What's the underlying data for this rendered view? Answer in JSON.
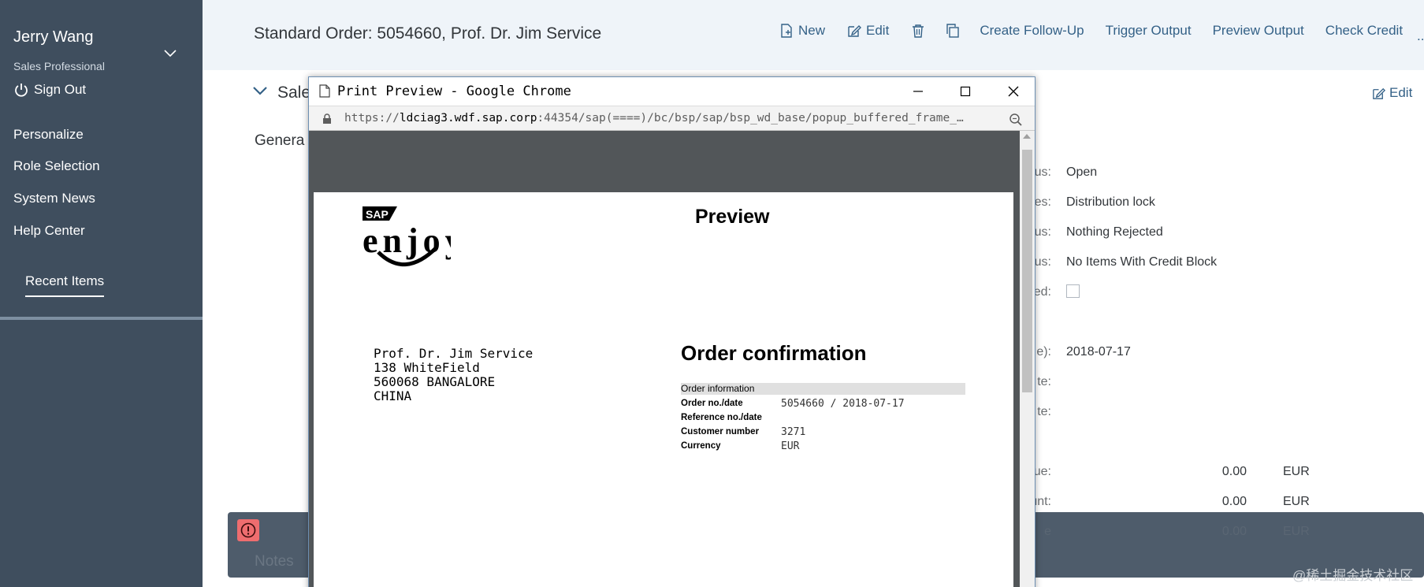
{
  "sidebar": {
    "user_name": "Jerry Wang",
    "user_role": "Sales Professional",
    "sign_out": "Sign Out",
    "links": [
      "Personalize",
      "Role Selection",
      "System News",
      "Help Center"
    ],
    "recent_items": "Recent Items"
  },
  "header": {
    "title": "Standard Order: 5054660, Prof. Dr. Jim Service",
    "new_label": "New",
    "edit_label": "Edit",
    "create_follow_up": "Create Follow-Up",
    "trigger_output": "Trigger Output",
    "preview_output": "Preview Output",
    "check_credit": "Check Credit",
    "more": "..."
  },
  "section": {
    "title": "Sale",
    "edit_label": "Edit",
    "general": "Genera"
  },
  "fields": [
    {
      "label": "us:",
      "value": "Open"
    },
    {
      "label": "es:",
      "value": "Distribution lock"
    },
    {
      "label": "us:",
      "value": "Nothing Rejected"
    },
    {
      "label": "us:",
      "value": "No Items With Credit Block"
    },
    {
      "label": "ed:",
      "value": ""
    },
    {
      "label": "e):",
      "value": "2018-07-17"
    },
    {
      "label": "te:",
      "value": ""
    },
    {
      "label": "te:",
      "value": ""
    }
  ],
  "amounts": [
    {
      "label": "ue:",
      "value": "0.00",
      "currency": "EUR"
    },
    {
      "label": "unt:",
      "value": "0.00",
      "currency": "EUR"
    },
    {
      "label": "e",
      "value": "0.00",
      "currency": "EUR"
    }
  ],
  "notes_label": "Notes",
  "popup": {
    "title": "Print Preview - Google Chrome",
    "url_prefix": "https://",
    "url_host": "ldciag3.wdf.sap.corp",
    "url_rest": ":44354/sap(====)/bc/bsp/sap/bsp_wd_base/popup_buffered_frame_…"
  },
  "document": {
    "logo_text_top": "SAP",
    "logo_text": "enjoy",
    "preview_label": "Preview",
    "address": [
      "Prof. Dr. Jim Service",
      "138 WhiteField",
      "560068 BANGALORE",
      "CHINA"
    ],
    "confirm_title": "Order confirmation",
    "order_info_header": "Order information",
    "rows": [
      {
        "label": "Order no./date",
        "value": "5054660  / 2018-07-17"
      },
      {
        "label": "Reference no./date",
        "value": ""
      },
      {
        "label": "Customer number",
        "value": "3271"
      },
      {
        "label": "Currency",
        "value": "EUR"
      }
    ]
  },
  "watermark": "@稀土掘金技术社区"
}
